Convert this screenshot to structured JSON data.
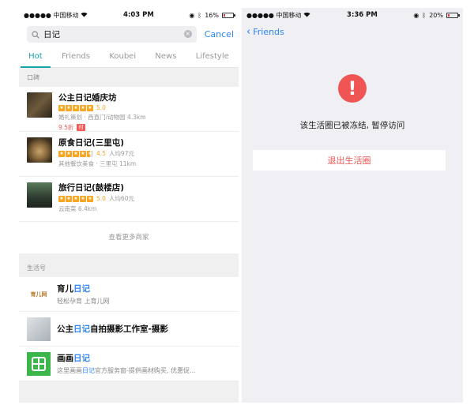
{
  "left": {
    "status": {
      "carrier": "●●●●● 中国移动",
      "time": "4:03 PM",
      "battery": "16%",
      "battery_level": 0.16
    },
    "search": {
      "query": "日记",
      "cancel": "Cancel"
    },
    "tabs": [
      "Hot",
      "Friends",
      "Koubei",
      "News",
      "Lifestyle"
    ],
    "koubei": {
      "label": "口碑",
      "items": [
        {
          "name": "公主日记婚庆坊",
          "score": "5.0",
          "stars": 5,
          "avg": "",
          "sub": "婚礼策划 · 西直门/动物园 4.3km",
          "discount": "9.5折",
          "badge": "付"
        },
        {
          "name": "原食日记(三里屯)",
          "score": "4.5",
          "stars": 4.5,
          "avg": "人均97元",
          "sub": "其他餐饮美食 · 三里屯 11km",
          "discount": "",
          "badge": ""
        },
        {
          "name": "旅行日记(鼓楼店)",
          "score": "5.0",
          "stars": 5,
          "avg": "人均60元",
          "sub": "云南菜 6.4km",
          "discount": "",
          "badge": ""
        }
      ],
      "more": "查看更多商家"
    },
    "lifestyle": {
      "label": "生活号",
      "items": [
        {
          "name_pre": "育儿",
          "name_hl": "日记",
          "name_post": "",
          "sub_pre": "轻松孕育 上育儿网",
          "sub_hl": "",
          "sub_post": ""
        },
        {
          "name_pre": "公主",
          "name_hl": "日记",
          "name_post": "自拍摄影工作室-摄影",
          "sub_pre": "",
          "sub_hl": "",
          "sub_post": ""
        },
        {
          "name_pre": "画画",
          "name_hl": "日记",
          "name_post": "",
          "sub_pre": "这里画画",
          "sub_hl": "日记",
          "sub_post": "官方服务窗-提供画材购买, 优惠促..."
        }
      ]
    }
  },
  "right": {
    "status": {
      "carrier": "●●●●● 中国移动",
      "time": "3:36 PM",
      "battery": "20%",
      "battery_level": 0.2
    },
    "back": "Friends",
    "alert_glyph": "!",
    "message": "该生活圈已被冻结, 暂停访问",
    "exit": "退出生活圈"
  },
  "colors": {
    "accent": "#16a3a3",
    "link": "#2b86f5",
    "alert": "#f05555",
    "star": "#f6a623"
  }
}
